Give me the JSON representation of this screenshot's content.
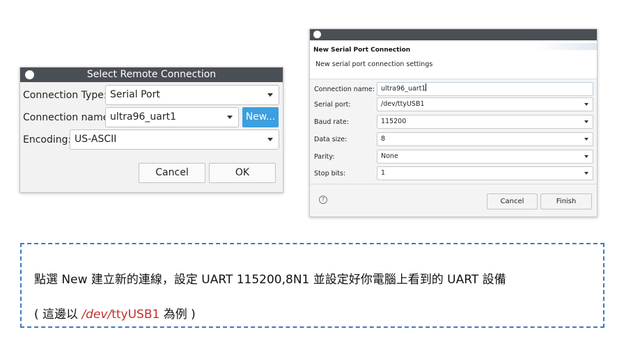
{
  "select_dialog": {
    "title": "Select Remote Connection",
    "connection_type_label": "Connection Type:",
    "connection_type_value": "Serial Port",
    "connection_name_label": "Connection name:",
    "connection_name_value": "ultra96_uart1",
    "new_button": "New...",
    "encoding_label": "Encoding:",
    "encoding_value": "US-ASCII",
    "cancel_button": "Cancel",
    "ok_button": "OK"
  },
  "serial_dialog": {
    "header_title": "New Serial Port Connection",
    "header_desc": "New serial port connection settings",
    "fields": {
      "connection_name": {
        "label": "Connection name:",
        "value": "ultra96_uart1"
      },
      "serial_port": {
        "label": "Serial port:",
        "value": "/dev/ttyUSB1"
      },
      "baud_rate": {
        "label": "Baud rate:",
        "value": "115200"
      },
      "data_size": {
        "label": "Data size:",
        "value": "8"
      },
      "parity": {
        "label": "Parity:",
        "value": "None"
      },
      "stop_bits": {
        "label": "Stop bits:",
        "value": "1"
      }
    },
    "help_icon": "?",
    "cancel_button": "Cancel",
    "finish_button": "Finish"
  },
  "note": {
    "line1": "點選  New  建立新的連線，設定  UART 115200,8N1  並設定好你電腦上看到的  UART  設備",
    "line2_prefix": "( 這邊以  ",
    "line2_red1": "/dev/",
    "line2_black": "ttyUSB1",
    "line2_suffix": "  為例 )"
  },
  "colors": {
    "titlebar": "#4a4f55",
    "new_button": "#3c9fe0",
    "note_border": "#3a7bbf",
    "highlight": "#c0302a"
  }
}
